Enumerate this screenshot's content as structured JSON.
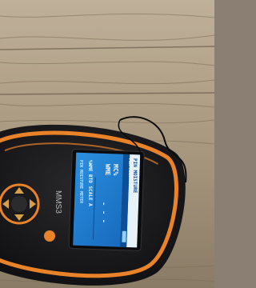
{
  "photo": {
    "subject": "moisture meter on wooden floor",
    "device": {
      "model_label": "MMS3",
      "screen": {
        "header": "PIN MOISTURE",
        "subheader": "PIN MOISTURE METER",
        "mode_lines": [
          "MC%",
          "WME"
        ],
        "reading": "- - -",
        "scale_line": "%WME BTD SCALE A",
        "footer": "PIN MOISTURE METER"
      }
    },
    "colors": {
      "wood_light": "#b8a78f",
      "wood_dark": "#7a6a55",
      "device_body": "#1c1c1e",
      "trim_orange": "#e8832a",
      "screen_blue": "#1f7fd0",
      "screen_dark": "#0d4f96"
    }
  }
}
